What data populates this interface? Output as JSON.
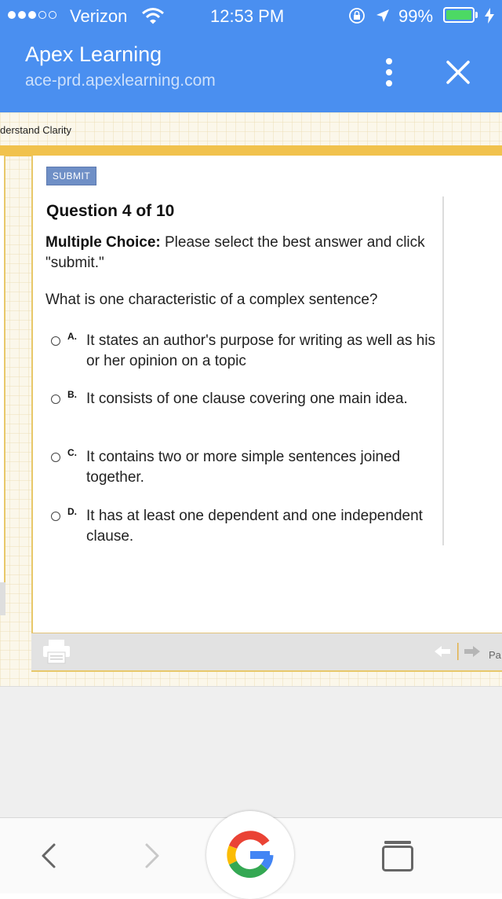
{
  "status_bar": {
    "carrier": "Verizon",
    "time": "12:53 PM",
    "battery": "99%",
    "battery_level": 0.99,
    "signal_bars_filled": 3,
    "signal_bars_total": 5
  },
  "header": {
    "title": "Apex Learning",
    "url": "ace-prd.apexlearning.com"
  },
  "breadcrumb": "derstand Clarity",
  "submit_label": "SUBMIT",
  "question": {
    "title": "Question 4 of 10",
    "instruction_bold": "Multiple Choice:",
    "instruction": " Please select the best answer and click \"submit.\"",
    "text": "What is one characteristic of a complex sentence?",
    "options": [
      {
        "letter": "A.",
        "text": "It states an author's purpose for writing as well as his or her opinion on a topic"
      },
      {
        "letter": "B.",
        "text": "It consists of one clause covering one main idea."
      },
      {
        "letter": "C.",
        "text": "It contains two or more simple sentences joined together."
      },
      {
        "letter": "D.",
        "text": "It has at least one dependent and one independent clause."
      }
    ]
  },
  "footer": {
    "page_label": "Pa"
  },
  "icons": [
    "wifi-icon",
    "lock-rotation-icon",
    "location-arrow-icon",
    "charging-icon",
    "more-vert-icon",
    "close-icon",
    "print-icon",
    "prev-arrow-icon",
    "next-arrow-icon",
    "back-icon",
    "forward-icon",
    "google-icon",
    "tabs-icon"
  ],
  "colors": {
    "header_bg": "#4a8ff0",
    "accent_orange": "#f1c24d",
    "submit_bg": "#6f8fc6",
    "battery_green": "#4cd964"
  }
}
